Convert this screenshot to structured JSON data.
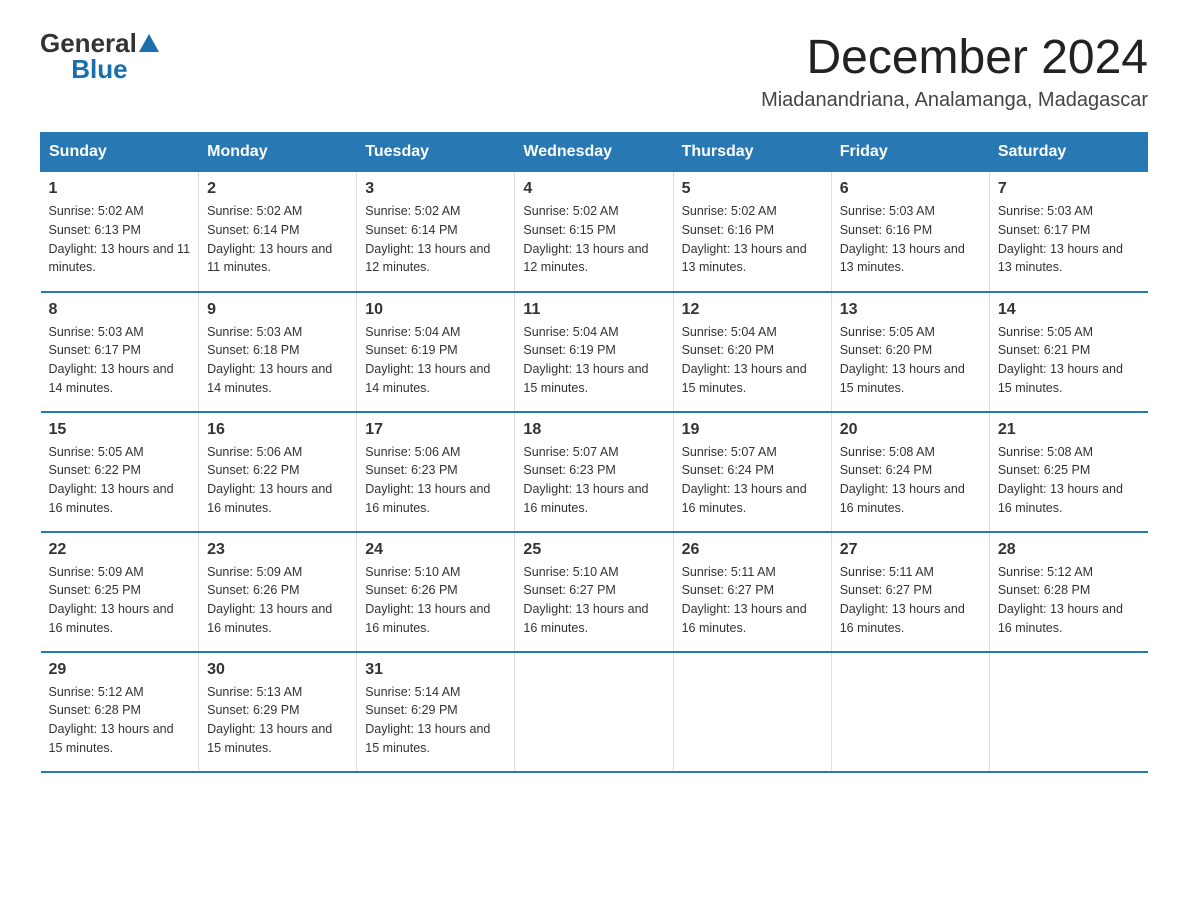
{
  "header": {
    "logo": {
      "general": "General",
      "blue": "Blue"
    },
    "title": "December 2024",
    "subtitle": "Miadanandriana, Analamanga, Madagascar"
  },
  "weekdays": [
    "Sunday",
    "Monday",
    "Tuesday",
    "Wednesday",
    "Thursday",
    "Friday",
    "Saturday"
  ],
  "weeks": [
    [
      {
        "day": "1",
        "sunrise": "5:02 AM",
        "sunset": "6:13 PM",
        "daylight": "13 hours and 11 minutes."
      },
      {
        "day": "2",
        "sunrise": "5:02 AM",
        "sunset": "6:14 PM",
        "daylight": "13 hours and 11 minutes."
      },
      {
        "day": "3",
        "sunrise": "5:02 AM",
        "sunset": "6:14 PM",
        "daylight": "13 hours and 12 minutes."
      },
      {
        "day": "4",
        "sunrise": "5:02 AM",
        "sunset": "6:15 PM",
        "daylight": "13 hours and 12 minutes."
      },
      {
        "day": "5",
        "sunrise": "5:02 AM",
        "sunset": "6:16 PM",
        "daylight": "13 hours and 13 minutes."
      },
      {
        "day": "6",
        "sunrise": "5:03 AM",
        "sunset": "6:16 PM",
        "daylight": "13 hours and 13 minutes."
      },
      {
        "day": "7",
        "sunrise": "5:03 AM",
        "sunset": "6:17 PM",
        "daylight": "13 hours and 13 minutes."
      }
    ],
    [
      {
        "day": "8",
        "sunrise": "5:03 AM",
        "sunset": "6:17 PM",
        "daylight": "13 hours and 14 minutes."
      },
      {
        "day": "9",
        "sunrise": "5:03 AM",
        "sunset": "6:18 PM",
        "daylight": "13 hours and 14 minutes."
      },
      {
        "day": "10",
        "sunrise": "5:04 AM",
        "sunset": "6:19 PM",
        "daylight": "13 hours and 14 minutes."
      },
      {
        "day": "11",
        "sunrise": "5:04 AM",
        "sunset": "6:19 PM",
        "daylight": "13 hours and 15 minutes."
      },
      {
        "day": "12",
        "sunrise": "5:04 AM",
        "sunset": "6:20 PM",
        "daylight": "13 hours and 15 minutes."
      },
      {
        "day": "13",
        "sunrise": "5:05 AM",
        "sunset": "6:20 PM",
        "daylight": "13 hours and 15 minutes."
      },
      {
        "day": "14",
        "sunrise": "5:05 AM",
        "sunset": "6:21 PM",
        "daylight": "13 hours and 15 minutes."
      }
    ],
    [
      {
        "day": "15",
        "sunrise": "5:05 AM",
        "sunset": "6:22 PM",
        "daylight": "13 hours and 16 minutes."
      },
      {
        "day": "16",
        "sunrise": "5:06 AM",
        "sunset": "6:22 PM",
        "daylight": "13 hours and 16 minutes."
      },
      {
        "day": "17",
        "sunrise": "5:06 AM",
        "sunset": "6:23 PM",
        "daylight": "13 hours and 16 minutes."
      },
      {
        "day": "18",
        "sunrise": "5:07 AM",
        "sunset": "6:23 PM",
        "daylight": "13 hours and 16 minutes."
      },
      {
        "day": "19",
        "sunrise": "5:07 AM",
        "sunset": "6:24 PM",
        "daylight": "13 hours and 16 minutes."
      },
      {
        "day": "20",
        "sunrise": "5:08 AM",
        "sunset": "6:24 PM",
        "daylight": "13 hours and 16 minutes."
      },
      {
        "day": "21",
        "sunrise": "5:08 AM",
        "sunset": "6:25 PM",
        "daylight": "13 hours and 16 minutes."
      }
    ],
    [
      {
        "day": "22",
        "sunrise": "5:09 AM",
        "sunset": "6:25 PM",
        "daylight": "13 hours and 16 minutes."
      },
      {
        "day": "23",
        "sunrise": "5:09 AM",
        "sunset": "6:26 PM",
        "daylight": "13 hours and 16 minutes."
      },
      {
        "day": "24",
        "sunrise": "5:10 AM",
        "sunset": "6:26 PM",
        "daylight": "13 hours and 16 minutes."
      },
      {
        "day": "25",
        "sunrise": "5:10 AM",
        "sunset": "6:27 PM",
        "daylight": "13 hours and 16 minutes."
      },
      {
        "day": "26",
        "sunrise": "5:11 AM",
        "sunset": "6:27 PM",
        "daylight": "13 hours and 16 minutes."
      },
      {
        "day": "27",
        "sunrise": "5:11 AM",
        "sunset": "6:27 PM",
        "daylight": "13 hours and 16 minutes."
      },
      {
        "day": "28",
        "sunrise": "5:12 AM",
        "sunset": "6:28 PM",
        "daylight": "13 hours and 16 minutes."
      }
    ],
    [
      {
        "day": "29",
        "sunrise": "5:12 AM",
        "sunset": "6:28 PM",
        "daylight": "13 hours and 15 minutes."
      },
      {
        "day": "30",
        "sunrise": "5:13 AM",
        "sunset": "6:29 PM",
        "daylight": "13 hours and 15 minutes."
      },
      {
        "day": "31",
        "sunrise": "5:14 AM",
        "sunset": "6:29 PM",
        "daylight": "13 hours and 15 minutes."
      },
      null,
      null,
      null,
      null
    ]
  ]
}
